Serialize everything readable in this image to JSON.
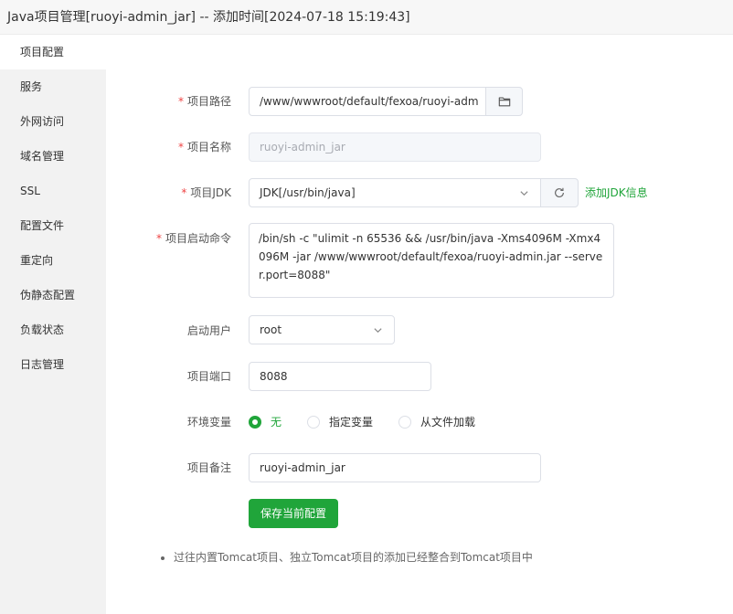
{
  "window": {
    "title": "Java项目管理[ruoyi-admin_jar] -- 添加时间[2024-07-18 15:19:43]"
  },
  "sidebar": {
    "items": [
      {
        "label": "项目配置",
        "active": true
      },
      {
        "label": "服务"
      },
      {
        "label": "外网访问"
      },
      {
        "label": "域名管理"
      },
      {
        "label": "SSL"
      },
      {
        "label": "配置文件"
      },
      {
        "label": "重定向"
      },
      {
        "label": "伪静态配置"
      },
      {
        "label": "负载状态"
      },
      {
        "label": "日志管理"
      }
    ]
  },
  "form": {
    "project_path": {
      "label": "项目路径",
      "required": "*",
      "value": "/www/wwwroot/default/fexoa/ruoyi-adm",
      "button_icon": "folder-icon"
    },
    "project_name": {
      "label": "项目名称",
      "required": "*",
      "value": "ruoyi-admin_jar"
    },
    "project_jdk": {
      "label": "项目JDK",
      "required": "*",
      "value": "JDK[/usr/bin/java]",
      "refresh_icon": "refresh-icon",
      "add_link": "添加JDK信息"
    },
    "start_command": {
      "label": "项目启动命令",
      "required": "*",
      "value": "/bin/sh -c \"ulimit -n 65536 && /usr/bin/java -Xms4096M -Xmx4096M -jar /www/wwwroot/default/fexoa/ruoyi-admin.jar --server.port=8088\""
    },
    "start_user": {
      "label": "启动用户",
      "value": "root"
    },
    "project_port": {
      "label": "项目端口",
      "value": "8088"
    },
    "env_vars": {
      "label": "环境变量",
      "options": [
        "无",
        "指定变量",
        "从文件加载"
      ],
      "selected": "无"
    },
    "project_note": {
      "label": "项目备注",
      "value": "ruoyi-admin_jar"
    },
    "save_button": "保存当前配置"
  },
  "notes": [
    "过往内置Tomcat项目、独立Tomcat项目的添加已经整合到Tomcat项目中"
  ],
  "colors": {
    "accent": "#20a53a",
    "required": "#ef4444"
  }
}
